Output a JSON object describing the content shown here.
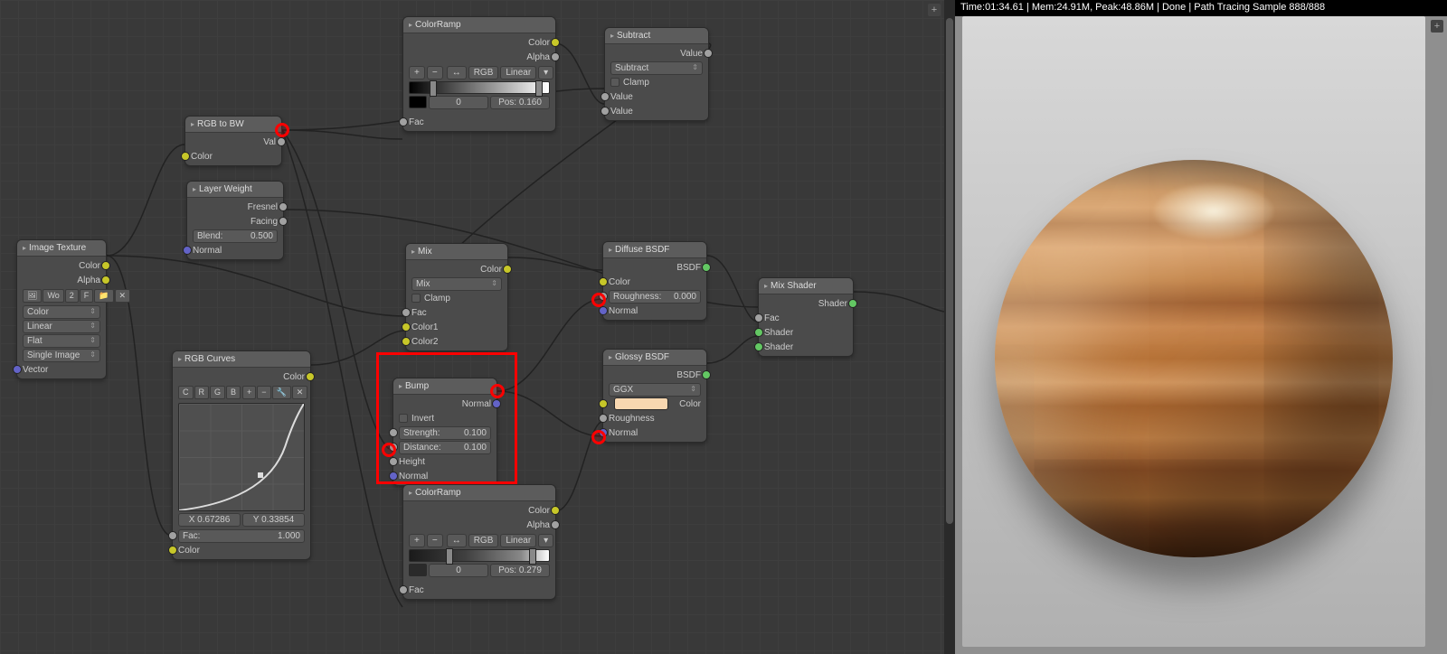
{
  "status_bar": "Time:01:34.61 | Mem:24.91M, Peak:48.86M | Done | Path Tracing Sample 888/888",
  "nodes": {
    "image_texture": {
      "title": "Image Texture",
      "out_color": "Color",
      "out_alpha": "Alpha",
      "img_label": "Wo",
      "img_btns": [
        "2",
        "F"
      ],
      "color_space": "Color",
      "interp": "Linear",
      "proj": "Flat",
      "source": "Single Image",
      "in_vector": "Vector"
    },
    "rgb_to_bw": {
      "title": "RGB to BW",
      "out": "Val",
      "in": "Color"
    },
    "layer_weight": {
      "title": "Layer Weight",
      "out_fresnel": "Fresnel",
      "out_facing": "Facing",
      "blend_l": "Blend:",
      "blend_v": "0.500",
      "in": "Normal"
    },
    "rgb_curves": {
      "title": "RGB Curves",
      "out": "Color",
      "tabs": [
        "C",
        "R",
        "G",
        "B"
      ],
      "x_l": "X",
      "x_v": "0.67286",
      "y_l": "Y",
      "y_v": "0.33854",
      "fac_l": "Fac:",
      "fac_v": "1.000",
      "in": "Color"
    },
    "color_ramp_top": {
      "title": "ColorRamp",
      "out_color": "Color",
      "out_alpha": "Alpha",
      "mode": "RGB",
      "interp": "Linear",
      "idx": "0",
      "pos_l": "Pos:",
      "pos_v": "0.160",
      "in": "Fac"
    },
    "color_ramp_bot": {
      "title": "ColorRamp",
      "out_color": "Color",
      "out_alpha": "Alpha",
      "mode": "RGB",
      "interp": "Linear",
      "idx": "0",
      "pos_l": "Pos:",
      "pos_v": "0.279",
      "in": "Fac"
    },
    "subtract": {
      "title": "Subtract",
      "out": "Value",
      "op": "Subtract",
      "clamp": "Clamp",
      "in1": "Value",
      "in2": "Value"
    },
    "mix": {
      "title": "Mix",
      "out": "Color",
      "blend": "Mix",
      "clamp": "Clamp",
      "in_fac": "Fac",
      "in_c1": "Color1",
      "in_c2": "Color2"
    },
    "bump": {
      "title": "Bump",
      "out": "Normal",
      "invert": "Invert",
      "str_l": "Strength:",
      "str_v": "0.100",
      "dist_l": "Distance:",
      "dist_v": "0.100",
      "in_h": "Height",
      "in_n": "Normal"
    },
    "diffuse": {
      "title": "Diffuse BSDF",
      "out": "BSDF",
      "in_color": "Color",
      "rough_l": "Roughness:",
      "rough_v": "0.000",
      "in_n": "Normal"
    },
    "glossy": {
      "title": "Glossy BSDF",
      "out": "BSDF",
      "dist": "GGX",
      "in_color": "Color",
      "in_rough": "Roughness",
      "in_n": "Normal"
    },
    "mix_shader": {
      "title": "Mix Shader",
      "out": "Shader",
      "in_fac": "Fac",
      "in_s1": "Shader",
      "in_s2": "Shader"
    }
  }
}
